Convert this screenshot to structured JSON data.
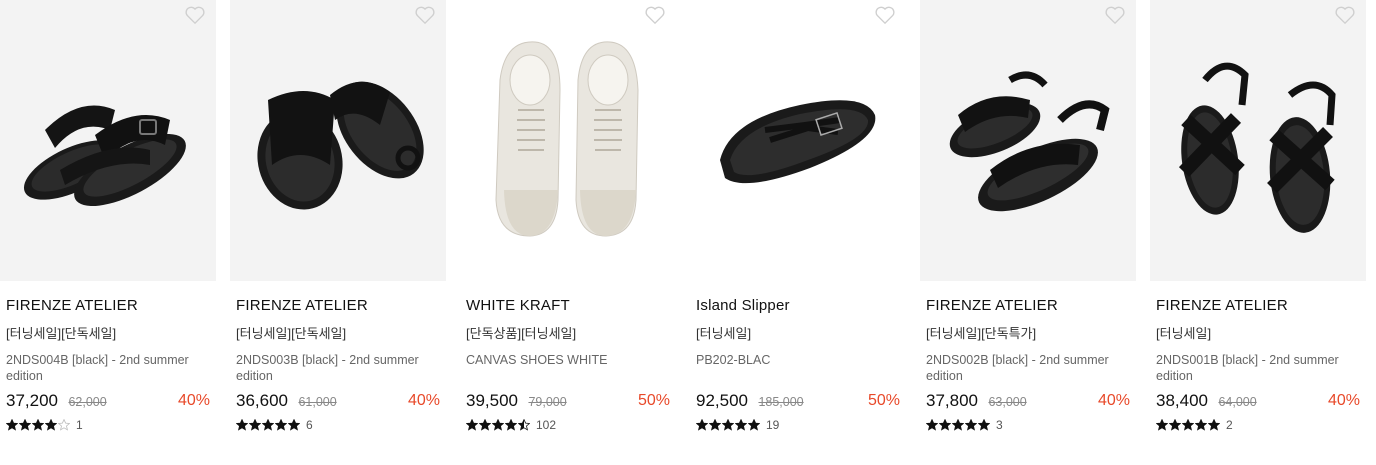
{
  "colors": {
    "discount": "#e8492a",
    "star": "#111111",
    "thumb_bg": "#f3f3f3"
  },
  "products": [
    {
      "brand": "FIRENZE ATELIER",
      "tags": "[터닝세일][단독세일]",
      "desc": "2NDS004B [black] - 2nd summer edition",
      "price": "37,200",
      "original_price": "62,000",
      "discount": "40%",
      "rating": 4,
      "review_count": "1",
      "image_icon": "black-buckle-slide-sandal"
    },
    {
      "brand": "FIRENZE ATELIER",
      "tags": "[터닝세일][단독세일]",
      "desc": "2NDS003B [black] - 2nd summer edition",
      "price": "36,600",
      "original_price": "61,000",
      "discount": "40%",
      "rating": 5,
      "review_count": "6",
      "image_icon": "black-toe-loop-slide-sandal"
    },
    {
      "brand": "WHITE KRAFT",
      "tags": "[단독상품][터닝세일]",
      "desc": "CANVAS SHOES WHITE",
      "price": "39,500",
      "original_price": "79,000",
      "discount": "50%",
      "rating": 4.5,
      "review_count": "102",
      "image_icon": "white-canvas-sneakers"
    },
    {
      "brand": "Island Slipper",
      "tags": "[터닝세일]",
      "desc": "PB202-BLAC",
      "price": "92,500",
      "original_price": "185,000",
      "discount": "50%",
      "rating": 5,
      "review_count": "19",
      "image_icon": "black-leather-flip-flop"
    },
    {
      "brand": "FIRENZE ATELIER",
      "tags": "[터닝세일][단독특가]",
      "desc": "2NDS002B [black] - 2nd summer edition",
      "price": "37,800",
      "original_price": "63,000",
      "discount": "40%",
      "rating": 5,
      "review_count": "3",
      "image_icon": "black-strap-sandal"
    },
    {
      "brand": "FIRENZE ATELIER",
      "tags": "[터닝세일]",
      "desc": "2NDS001B [black] - 2nd summer edition",
      "price": "38,400",
      "original_price": "64,000",
      "discount": "40%",
      "rating": 5,
      "review_count": "2",
      "image_icon": "black-cross-strap-sandal"
    }
  ]
}
